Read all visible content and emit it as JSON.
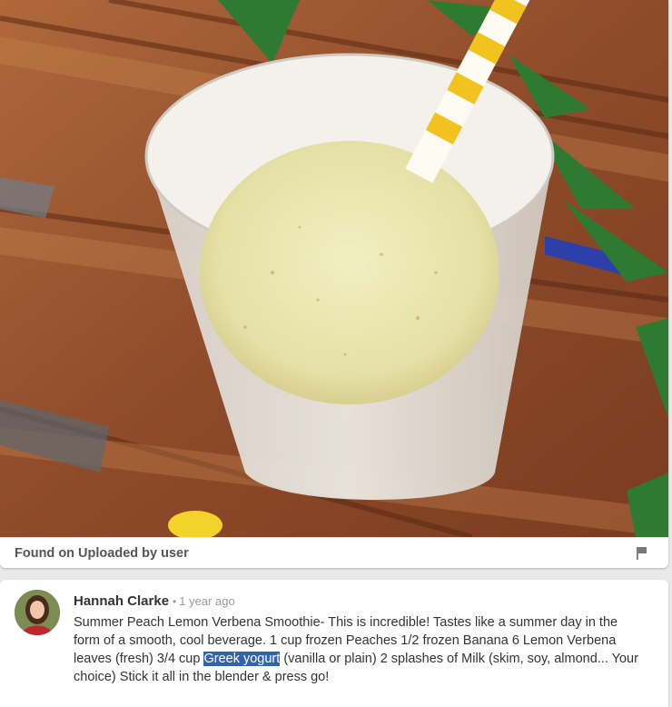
{
  "pin": {
    "image_alt": "Summer Peach Lemon Verbena Smoothie in a frosted glass with a yellow striped straw on a wooden tray",
    "source_text": "Found on Uploaded by user",
    "flag_icon": "flag-icon"
  },
  "comment": {
    "author": "Hannah Clarke",
    "separator": "•",
    "time": "1 year ago",
    "text_before": "Summer Peach Lemon Verbena Smoothie- This is incredible! Tastes like a summer day in the form of a smooth, cool beverage. 1 cup frozen Peaches 1/2 frozen Banana 6 Lemon Verbena leaves (fresh) 3/4 cup ",
    "text_highlight": "Greek yogurt",
    "text_after": " (vanilla or plain) 2 splashes of Milk (skim, soy, almond... Your choice) Stick it all in the blender & press go!"
  },
  "colors": {
    "highlight": "#3164ab",
    "wood": "#9a5632",
    "smoothie": "#eae7b0",
    "straw_stripe": "#f2c21f"
  }
}
